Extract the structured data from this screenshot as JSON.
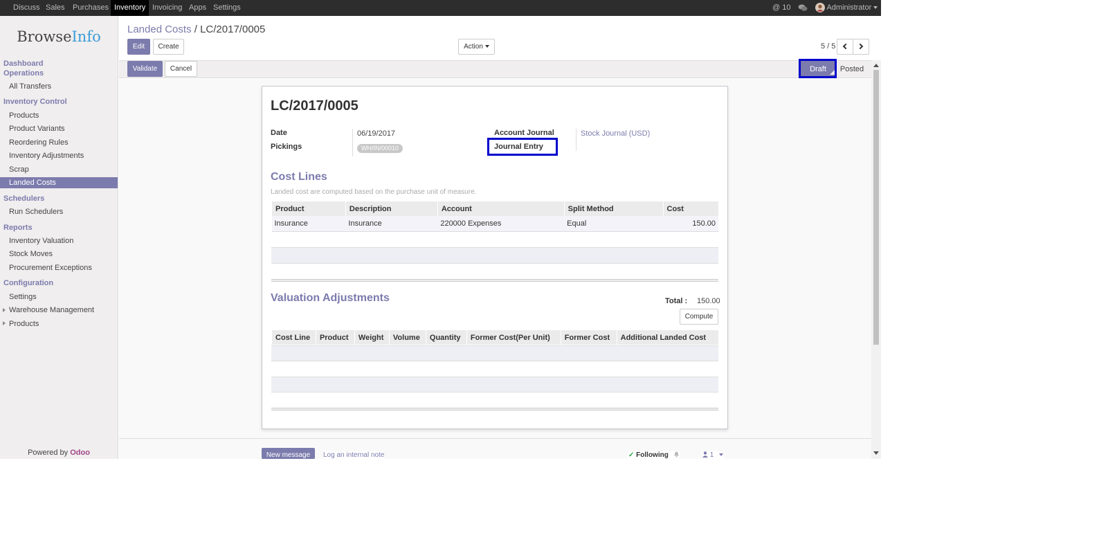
{
  "topbar": {
    "menu": [
      "Discuss",
      "Sales",
      "Purchases",
      "Inventory",
      "Invoicing",
      "Apps",
      "Settings"
    ],
    "active_menu": "Inventory",
    "notifications": "10",
    "user": "Administrator"
  },
  "sidebar": {
    "logo_part1": "Browse",
    "logo_part2": "Info",
    "sections": [
      {
        "head": "Dashboard",
        "head2": "Operations",
        "items": [
          "All Transfers"
        ]
      },
      {
        "head": "Inventory Control",
        "items": [
          "Products",
          "Product Variants",
          "Reordering Rules",
          "Inventory Adjustments",
          "Scrap",
          "Landed Costs"
        ]
      },
      {
        "head": "Schedulers",
        "items": [
          "Run Schedulers"
        ]
      },
      {
        "head": "Reports",
        "items": [
          "Inventory Valuation",
          "Stock Moves",
          "Procurement Exceptions"
        ]
      },
      {
        "head": "Configuration",
        "items": [
          "Settings",
          "Warehouse Management",
          "Products"
        ]
      }
    ],
    "active_item": "Landed Costs",
    "powered_by": "Powered by",
    "powered_brand": "Odoo"
  },
  "control": {
    "breadcrumb_parent": "Landed Costs",
    "breadcrumb_sep": "/",
    "breadcrumb_current": "LC/2017/0005",
    "edit_label": "Edit",
    "create_label": "Create",
    "action_label": "Action",
    "pager": "5 / 5"
  },
  "statusbar": {
    "validate_label": "Validate",
    "cancel_label": "Cancel",
    "stages": [
      "Draft",
      "Posted"
    ],
    "active_stage": "Draft"
  },
  "form": {
    "title": "LC/2017/0005",
    "date_label": "Date",
    "date_value": "06/19/2017",
    "pickings_label": "Pickings",
    "pickings_tag": "WH/IN/00010",
    "account_journal_label": "Account Journal",
    "account_journal_value": "Stock Journal (USD)",
    "journal_entry_label": "Journal Entry",
    "cost_lines_title": "Cost Lines",
    "cost_lines_note": "Landed cost are computed based on the purchase unit of measure.",
    "cost_columns": [
      "Product",
      "Description",
      "Account",
      "Split Method",
      "Cost"
    ],
    "cost_rows": [
      [
        "Insurance",
        "Insurance",
        "220000 Expenses",
        "Equal",
        "150.00"
      ]
    ],
    "valuation_title": "Valuation Adjustments",
    "total_label": "Total :",
    "total_value": "150.00",
    "compute_label": "Compute",
    "valuation_columns": [
      "Cost Line",
      "Product",
      "Weight",
      "Volume",
      "Quantity",
      "Former Cost(Per Unit)",
      "Former Cost",
      "Additional Landed Cost"
    ]
  },
  "chatter": {
    "new_message": "New message",
    "log_note": "Log an internal note",
    "following": "Following",
    "followers": "1"
  },
  "colors": {
    "accent": "#7c7bad",
    "highlight_box": "#0000cc",
    "topbar": "#2d2d2d"
  }
}
